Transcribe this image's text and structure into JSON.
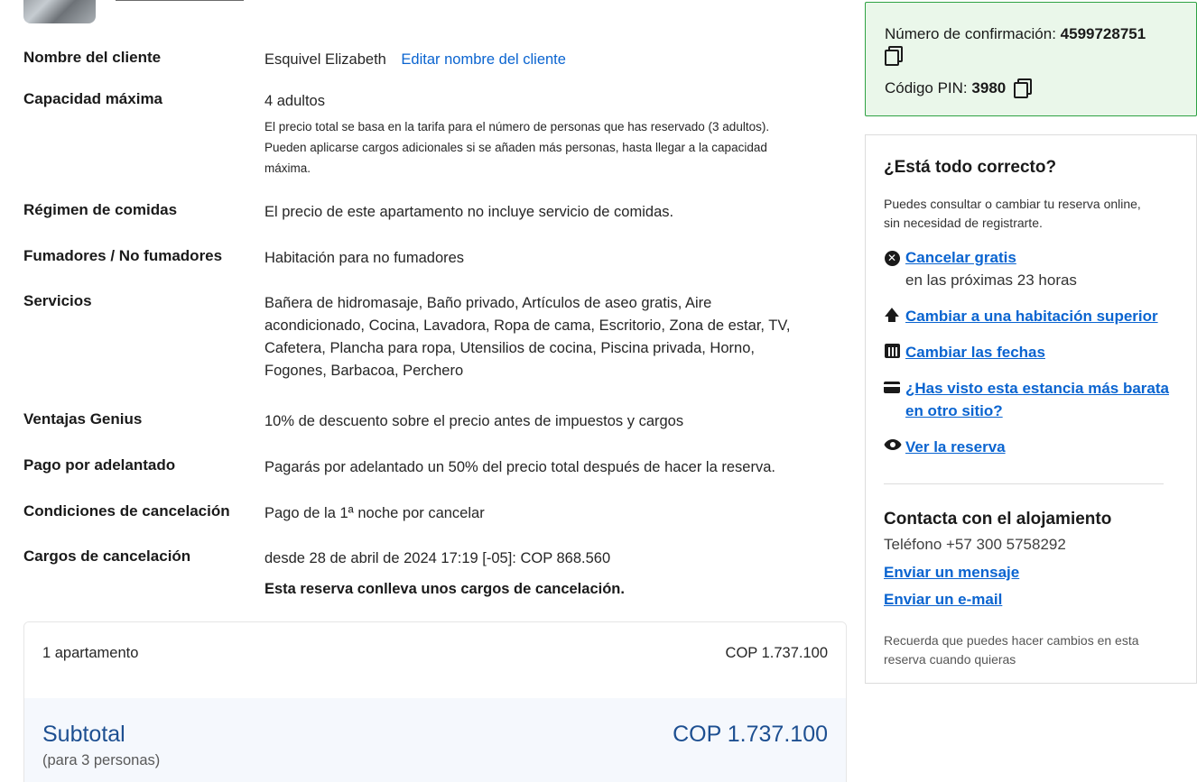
{
  "details": {
    "customer_name_label": "Nombre del cliente",
    "customer_name": "Esquivel Elizabeth",
    "edit_customer_link": "Editar nombre del cliente",
    "capacity_label": "Capacidad máxima",
    "capacity_value": "4 adultos",
    "capacity_note": "El precio total se basa en la tarifa para el número de personas que has reservado (3 adultos). Pueden aplicarse cargos adicionales si se añaden más personas, hasta llegar a la capacidad máxima.",
    "meals_label": "Régimen de comidas",
    "meals_value": "El precio de este apartamento no incluye servicio de comidas.",
    "smoking_label": "Fumadores / No fumadores",
    "smoking_value": "Habitación para no fumadores",
    "services_label": "Servicios",
    "services_value": "Bañera de hidromasaje, Baño privado, Artículos de aseo gratis, Aire acondicionado, Cocina, Lavadora, Ropa de cama, Escritorio, Zona de estar, TV, Cafetera, Plancha para ropa, Utensilios de cocina, Piscina privada, Horno, Fogones, Barbacoa, Perchero",
    "genius_label": "Ventajas Genius",
    "genius_value": "10% de descuento sobre el precio antes de impuestos y cargos",
    "prepay_label": "Pago por adelantado",
    "prepay_value": "Pagarás por adelantado un 50% del precio total después de hacer la reserva.",
    "cancel_cond_label": "Condiciones de cancelación",
    "cancel_cond_value": "Pago de la 1ª noche por cancelar",
    "cancel_fee_label": "Cargos de cancelación",
    "cancel_fee_value": "desde 28 de abril de 2024 17:19 [-05]: COP 868.560",
    "cancel_fee_note": "Esta reserva conlleva unos cargos de cancelación."
  },
  "price": {
    "apartment_label": "1 apartamento",
    "apartment_price": "COP 1.737.100",
    "subtotal_label": "Subtotal",
    "subtotal_note": "(para 3 personas)",
    "subtotal_price": "COP 1.737.100"
  },
  "confirmation": {
    "number_label": "Número de confirmación:",
    "number": "4599728751",
    "pin_label": "Código PIN:",
    "pin": "3980"
  },
  "sidebar": {
    "title": "¿Está todo correcto?",
    "text": "Puedes consultar o cambiar tu reserva online, sin necesidad de registrarte.",
    "actions": [
      {
        "icon": "cancel-icon",
        "label": "Cancelar gratis",
        "sub": "en las próximas 23 horas"
      },
      {
        "icon": "arrow-up-icon",
        "label": "Cambiar a una habitación superior"
      },
      {
        "icon": "calendar-icon",
        "label": "Cambiar las fechas"
      },
      {
        "icon": "credit-card-icon",
        "label": "¿Has visto esta estancia más barata en otro sitio?"
      },
      {
        "icon": "eye-icon",
        "label": "Ver la reserva"
      }
    ],
    "contact_title": "Contacta con el alojamiento",
    "phone": "Teléfono +57 300 5758292",
    "message_link": "Enviar un mensaje",
    "email_link": "Enviar un e-mail",
    "footnote": "Recuerda que puedes hacer cambios en esta reserva cuando quieras"
  },
  "colors": {
    "link": "#0a64d0",
    "confirm_bg": "#eaf7ea",
    "confirm_border": "#2ea243",
    "subtotal": "#1d4f91"
  }
}
